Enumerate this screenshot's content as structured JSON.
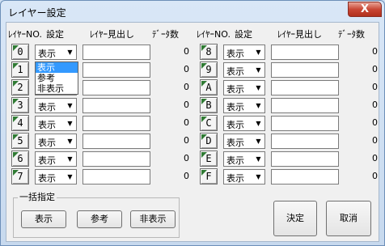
{
  "window": {
    "title": "レイヤー設定",
    "close_label": "X"
  },
  "headers": {
    "layer_no": "ﾚｲﾔｰNO.",
    "setting": "設定",
    "heading": "ﾚｲﾔｰ見出し",
    "data_count": "ﾃﾞｰﾀ数"
  },
  "left_layers": [
    {
      "num": "0",
      "mode": "表示",
      "heading": "",
      "count": "0"
    },
    {
      "num": "1",
      "mode": "表示",
      "heading": "",
      "count": "0"
    },
    {
      "num": "2",
      "mode": "表示",
      "heading": "",
      "count": "0"
    },
    {
      "num": "3",
      "mode": "表示",
      "heading": "",
      "count": "0"
    },
    {
      "num": "4",
      "mode": "表示",
      "heading": "",
      "count": "0"
    },
    {
      "num": "5",
      "mode": "表示",
      "heading": "",
      "count": "0"
    },
    {
      "num": "6",
      "mode": "表示",
      "heading": "",
      "count": "0"
    },
    {
      "num": "7",
      "mode": "表示",
      "heading": "",
      "count": "0"
    }
  ],
  "right_layers": [
    {
      "num": "8",
      "mode": "表示",
      "heading": "",
      "count": "0"
    },
    {
      "num": "9",
      "mode": "表示",
      "heading": "",
      "count": "0"
    },
    {
      "num": "A",
      "mode": "表示",
      "heading": "",
      "count": "0"
    },
    {
      "num": "B",
      "mode": "表示",
      "heading": "",
      "count": "0"
    },
    {
      "num": "C",
      "mode": "表示",
      "heading": "",
      "count": "0"
    },
    {
      "num": "D",
      "mode": "表示",
      "heading": "",
      "count": "0"
    },
    {
      "num": "E",
      "mode": "表示",
      "heading": "",
      "count": "0"
    },
    {
      "num": "F",
      "mode": "表示",
      "heading": "",
      "count": "0"
    }
  ],
  "dropdown": {
    "options": [
      "表示",
      "参考",
      "非表示"
    ],
    "highlighted": "表示"
  },
  "bulk": {
    "title": "一括指定",
    "show_label": "表示",
    "reference_label": "参考",
    "hide_label": "非表示"
  },
  "actions": {
    "ok_label": "決定",
    "cancel_label": "取消"
  }
}
